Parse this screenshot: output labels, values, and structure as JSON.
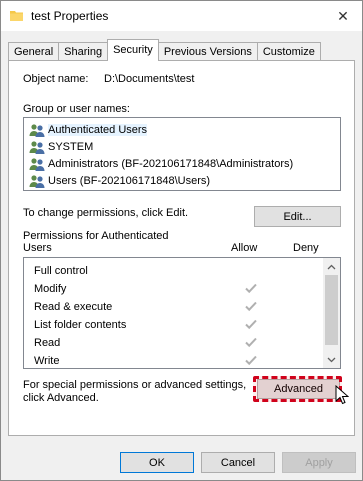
{
  "window": {
    "title": "test Properties",
    "close_glyph": "✕"
  },
  "tabs": [
    {
      "label": "General",
      "active": false
    },
    {
      "label": "Sharing",
      "active": false
    },
    {
      "label": "Security",
      "active": true
    },
    {
      "label": "Previous Versions",
      "active": false
    },
    {
      "label": "Customize",
      "active": false
    }
  ],
  "object": {
    "label": "Object name:",
    "value": "D:\\Documents\\test"
  },
  "groups": {
    "label": "Group or user names:",
    "items": [
      {
        "label": "Authenticated Users",
        "icon": "users-icon",
        "selected": true
      },
      {
        "label": "SYSTEM",
        "icon": "users-icon",
        "selected": false
      },
      {
        "label": "Administrators (BF-202106171848\\Administrators)",
        "icon": "users-icon",
        "selected": false
      },
      {
        "label": "Users (BF-202106171848\\Users)",
        "icon": "users-icon",
        "selected": false
      }
    ]
  },
  "change_permissions": {
    "text": "To change permissions, click Edit.",
    "edit_label": "Edit..."
  },
  "permissions": {
    "title": "Permissions for Authenticated",
    "subject": "Users",
    "allow_header": "Allow",
    "deny_header": "Deny",
    "rows": [
      {
        "label": "Full control",
        "allow": false,
        "deny": false
      },
      {
        "label": "Modify",
        "allow": true,
        "deny": false
      },
      {
        "label": "Read & execute",
        "allow": true,
        "deny": false
      },
      {
        "label": "List folder contents",
        "allow": true,
        "deny": false
      },
      {
        "label": "Read",
        "allow": true,
        "deny": false
      },
      {
        "label": "Write",
        "allow": true,
        "deny": false
      }
    ]
  },
  "advanced": {
    "text_line1": "For special permissions or advanced settings,",
    "text_line2": "click Advanced.",
    "button_label": "Advanced"
  },
  "footer": {
    "ok": "OK",
    "cancel": "Cancel",
    "apply": "Apply"
  },
  "colors": {
    "highlight": "#d0021b",
    "check": "#b0b0b0",
    "selected_bg": "#e5f3ff"
  }
}
